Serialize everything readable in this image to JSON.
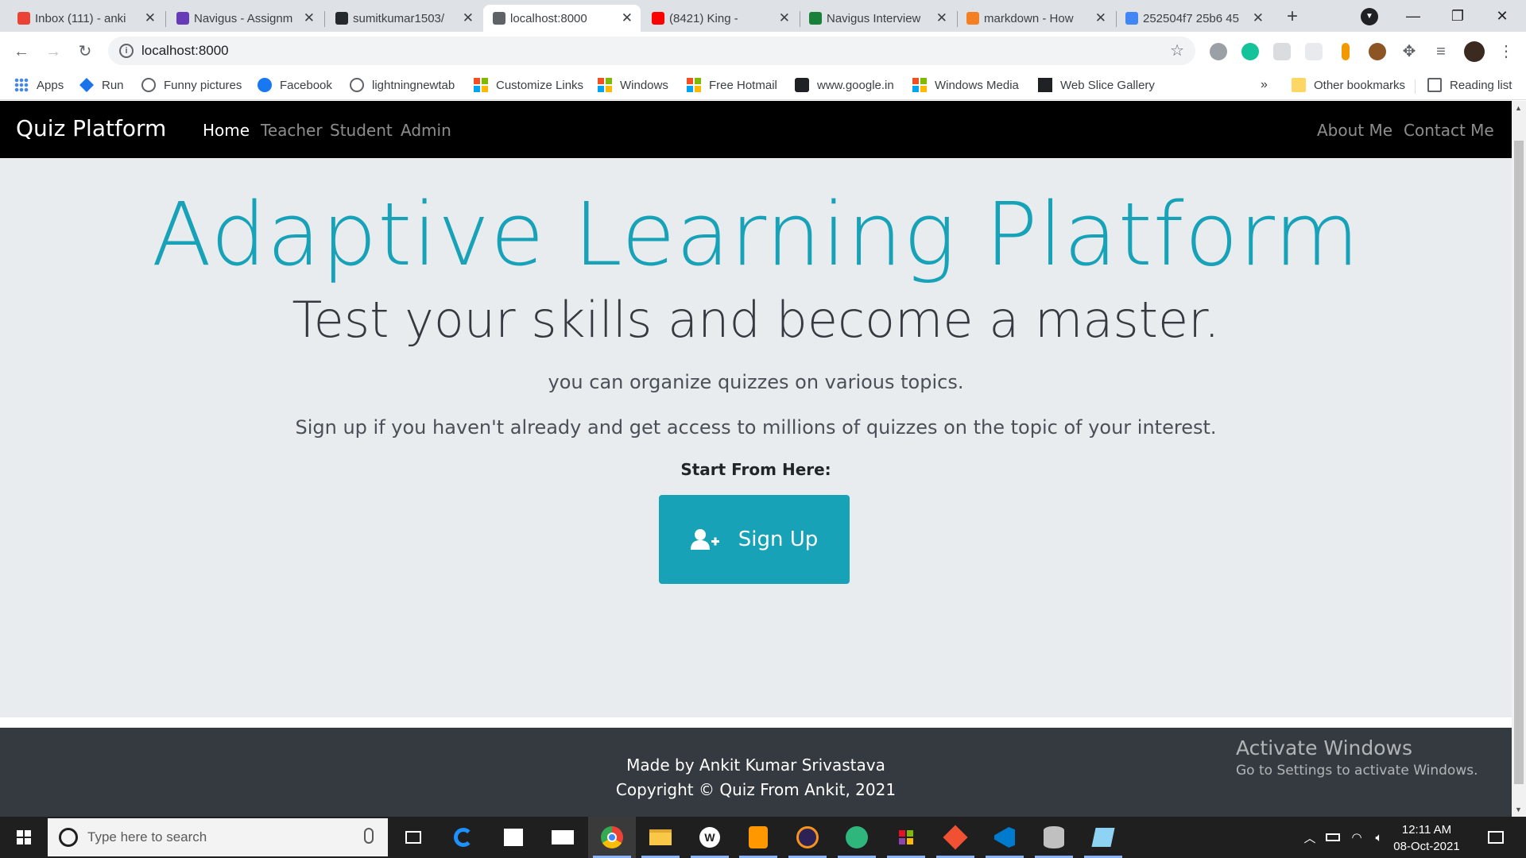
{
  "browser": {
    "tabs": [
      {
        "title": "Inbox (111) - anki",
        "icon": "gmail-icon",
        "color": "#ea4335"
      },
      {
        "title": "Navigus - Assignm",
        "icon": "forms-icon",
        "color": "#673ab7"
      },
      {
        "title": "sumitkumar1503/",
        "icon": "github-icon",
        "color": "#24292e"
      },
      {
        "title": "localhost:8000",
        "icon": "globe-icon",
        "color": "#5f6368"
      },
      {
        "title": "(8421) King -",
        "icon": "youtube-icon",
        "color": "#ff0000"
      },
      {
        "title": "Navigus Interview",
        "icon": "link-icon",
        "color": "#188038"
      },
      {
        "title": "markdown - How",
        "icon": "stackoverflow-icon",
        "color": "#f48024"
      },
      {
        "title": "252504f7 25b6 45",
        "icon": "document-icon",
        "color": "#4285f4"
      }
    ],
    "active_tab": 3,
    "url": "localhost:8000",
    "bookmarks": [
      {
        "label": "Apps",
        "icon": "apps-grid-icon"
      },
      {
        "label": "Run",
        "icon": "run-icon"
      },
      {
        "label": "Funny pictures",
        "icon": "globe-icon"
      },
      {
        "label": "Facebook",
        "icon": "facebook-icon"
      },
      {
        "label": "lightningnewtab",
        "icon": "globe-icon"
      },
      {
        "label": "Customize Links",
        "icon": "windows-icon"
      },
      {
        "label": "Windows",
        "icon": "windows-icon"
      },
      {
        "label": "Free Hotmail",
        "icon": "windows-icon"
      },
      {
        "label": "www.google.in",
        "icon": "infinity-icon"
      },
      {
        "label": "Windows Media",
        "icon": "windows-icon"
      },
      {
        "label": "Web Slice Gallery",
        "icon": "slice-icon"
      }
    ],
    "bookmarks_overflow": "»",
    "other_bookmarks": "Other bookmarks",
    "reading_list": "Reading list"
  },
  "site": {
    "brand": "Quiz Platform",
    "nav_left": [
      "Home",
      "Teacher",
      "Student",
      "Admin"
    ],
    "nav_active": 0,
    "nav_right": [
      "About Me",
      "Contact Me"
    ],
    "hero": {
      "title": "Adaptive Learning Platform",
      "subtitle": "Test your skills and become a master.",
      "line1": "you can organize quizzes on various topics.",
      "line2": "Sign up if you haven't already and get access to millions of quizzes on the topic of your interest.",
      "start_label": "Start From Here:",
      "signup_label": "Sign Up"
    },
    "footer": {
      "line1": "Made by Ankit Kumar Srivastava",
      "line2": "Copyright © Quiz From Ankit, 2021"
    },
    "colors": {
      "accent": "#17a2b8",
      "navbar": "#000000",
      "jumbotron": "#e9ecef",
      "footer": "#343a40"
    }
  },
  "watermark": {
    "title": "Activate Windows",
    "subtitle": "Go to Settings to activate Windows."
  },
  "taskbar": {
    "search_placeholder": "Type here to search",
    "time": "12:11 AM",
    "date": "08-Oct-2021"
  }
}
